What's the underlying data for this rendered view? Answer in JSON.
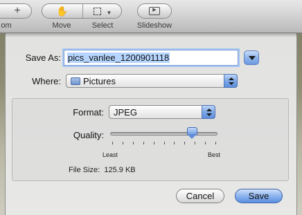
{
  "toolbar": {
    "zoom_label": "om",
    "move_label": "Move",
    "select_label": "Select",
    "slideshow_label": "Slideshow"
  },
  "save_dialog": {
    "save_as_label": "Save As:",
    "filename": "pics_vanlee_1200901118",
    "where_label": "Where:",
    "where_value": "Pictures",
    "format_label": "Format:",
    "format_value": "JPEG",
    "quality_label": "Quality:",
    "quality_level_fraction": 0.77,
    "quality_min_label": "Least",
    "quality_max_label": "Best",
    "file_size_label": "File Size:",
    "file_size_value": "125.9 KB",
    "cancel_label": "Cancel",
    "save_label": "Save"
  },
  "colors": {
    "accent_blue": "#6c99df",
    "selection": "#b5d5ff"
  }
}
